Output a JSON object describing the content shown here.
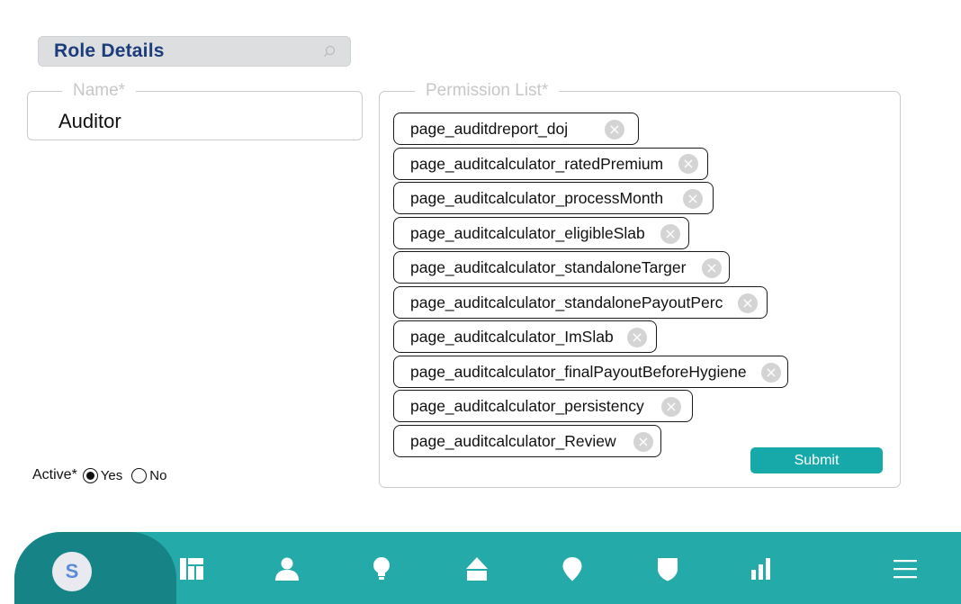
{
  "header": {
    "title": "Role Details"
  },
  "name_field": {
    "legend": "Name*",
    "value": "Auditor"
  },
  "permissions": {
    "legend": "Permission List*",
    "chips": [
      "page_auditdreport_doj",
      "page_auditcalculator_ratedPremium",
      "page_auditcalculator_processMonth",
      "page_auditcalculator_eligibleSlab",
      "page_auditcalculator_standaloneTarger",
      "page_auditcalculator_standalonePayoutPerc",
      "page_auditcalculator_ImSlab",
      "page_auditcalculator_finalPayoutBeforeHygiene",
      "page_auditcalculator_persistency",
      "page_auditcalculator_Review"
    ],
    "remove_glyph": "×",
    "submit_label": "Submit"
  },
  "active": {
    "label": "Active*",
    "options": [
      "Yes",
      "No"
    ],
    "selected": "Yes"
  },
  "nav": {
    "avatar_letter": "S",
    "icons": [
      "dashboard-icon",
      "user-icon",
      "bulb-icon",
      "home-icon",
      "location-pin-icon",
      "shield-icon",
      "bar-chart-icon",
      "menu-icon"
    ]
  },
  "colors": {
    "header_title": "#1c3c7c",
    "accent": "#23aaa9",
    "accent_dark": "#168387",
    "submit": "#17a9aa"
  }
}
